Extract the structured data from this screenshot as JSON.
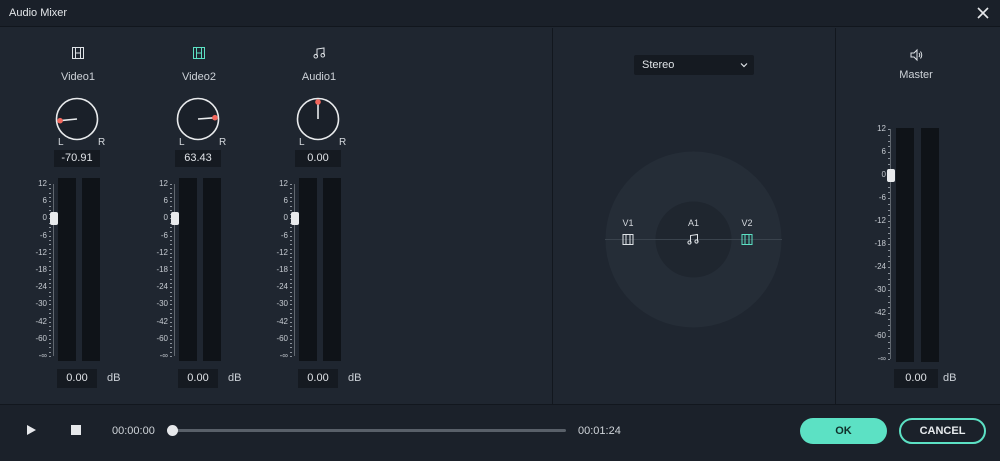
{
  "window": {
    "title": "Audio Mixer"
  },
  "channels": [
    {
      "name": "Video1",
      "icon": "video-clip-icon",
      "pan_value": "-70.91",
      "db_value": "0.00",
      "fader_db": 0,
      "accent": "#dfe3e7"
    },
    {
      "name": "Video2",
      "icon": "video-clip-icon",
      "pan_value": "63.43",
      "db_value": "0.00",
      "fader_db": 0,
      "accent": "#5ce1c4"
    },
    {
      "name": "Audio1",
      "icon": "music-note-icon",
      "pan_value": "0.00",
      "db_value": "0.00",
      "fader_db": 0,
      "accent": "#dfe3e7"
    }
  ],
  "knob_labels": {
    "left": "L",
    "right": "R"
  },
  "scale_ticks": [
    "12",
    "6",
    "0",
    "-6",
    "-12",
    "-18",
    "-24",
    "-30",
    "-42",
    "-60",
    "-∞"
  ],
  "master_ticks": [
    "12",
    "6",
    "0",
    "-6",
    "-12",
    "-18",
    "-24",
    "-30",
    "-42",
    "-60",
    "-∞"
  ],
  "db_unit": "dB",
  "pan": {
    "mode": "Stereo",
    "labels": {
      "v1": "V1",
      "a1": "A1",
      "v2": "V2"
    }
  },
  "master": {
    "name": "Master",
    "db_value": "0.00",
    "icon": "speaker-icon"
  },
  "transport": {
    "current_time": "00:00:00",
    "total_time": "00:01:24",
    "progress": 0
  },
  "buttons": {
    "ok": "OK",
    "cancel": "CANCEL"
  },
  "colors": {
    "accent": "#5ce1c4",
    "knob_dot": "#f2665c"
  }
}
